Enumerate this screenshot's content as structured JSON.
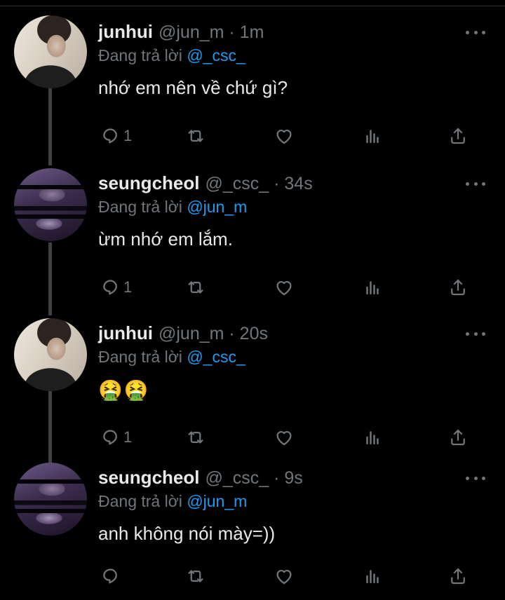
{
  "theme": {
    "background": "#000000",
    "text": "#e7e9ea",
    "muted": "#71767b",
    "accent": "#1d9bf0"
  },
  "replying_prefix": "Đang trả lời",
  "tweets": [
    {
      "name": "junhui",
      "handle": "@jun_m · 1m",
      "replying_to": "@_csc_",
      "text": "nhớ em nên về chứ gì?",
      "reply_count": "1",
      "avatar": "junhui-avatar"
    },
    {
      "name": "seungcheol",
      "handle": "@_csc_ · 34s",
      "replying_to": "@jun_m",
      "text": "ừm nhớ em lắm.",
      "reply_count": "1",
      "avatar": "seungcheol-avatar"
    },
    {
      "name": "junhui",
      "handle": "@jun_m · 20s",
      "replying_to": "@_csc_",
      "text": "🤮🤮",
      "reply_count": "1",
      "avatar": "junhui-avatar"
    },
    {
      "name": "seungcheol",
      "handle": "@_csc_ · 9s",
      "replying_to": "@jun_m",
      "text": "anh không nói mày=))",
      "reply_count": "",
      "avatar": "seungcheol-avatar"
    }
  ],
  "icons": {
    "reply": "reply-icon",
    "retweet": "retweet-icon",
    "like": "heart-icon",
    "views": "analytics-icon",
    "share": "share-icon",
    "more": "more-icon"
  }
}
